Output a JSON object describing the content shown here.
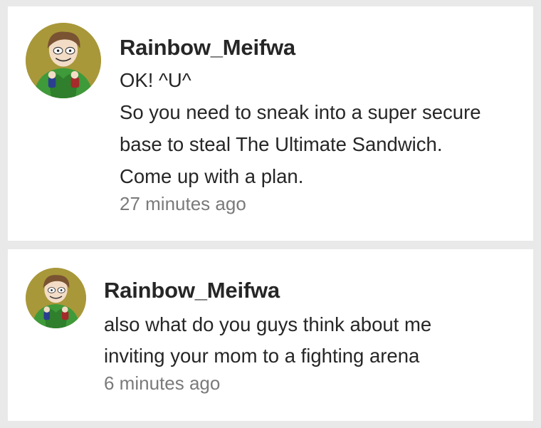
{
  "comments": [
    {
      "avatar_icon": "user-avatar-icon",
      "username": "Rainbow_Meifwa",
      "message": "OK! ^U^\nSo you need to sneak into a super secure\nbase to steal The Ultimate Sandwich.\nCome up with a plan.",
      "timestamp": "27 minutes ago"
    },
    {
      "avatar_icon": "user-avatar-icon",
      "username": "Rainbow_Meifwa",
      "message": "also what do you guys think about me\ninviting your mom to a fighting arena",
      "timestamp": "6 minutes ago"
    }
  ],
  "colors": {
    "background": "#e9e9e9",
    "card": "#ffffff",
    "text": "#262626",
    "timestamp": "#7a7a7a"
  }
}
